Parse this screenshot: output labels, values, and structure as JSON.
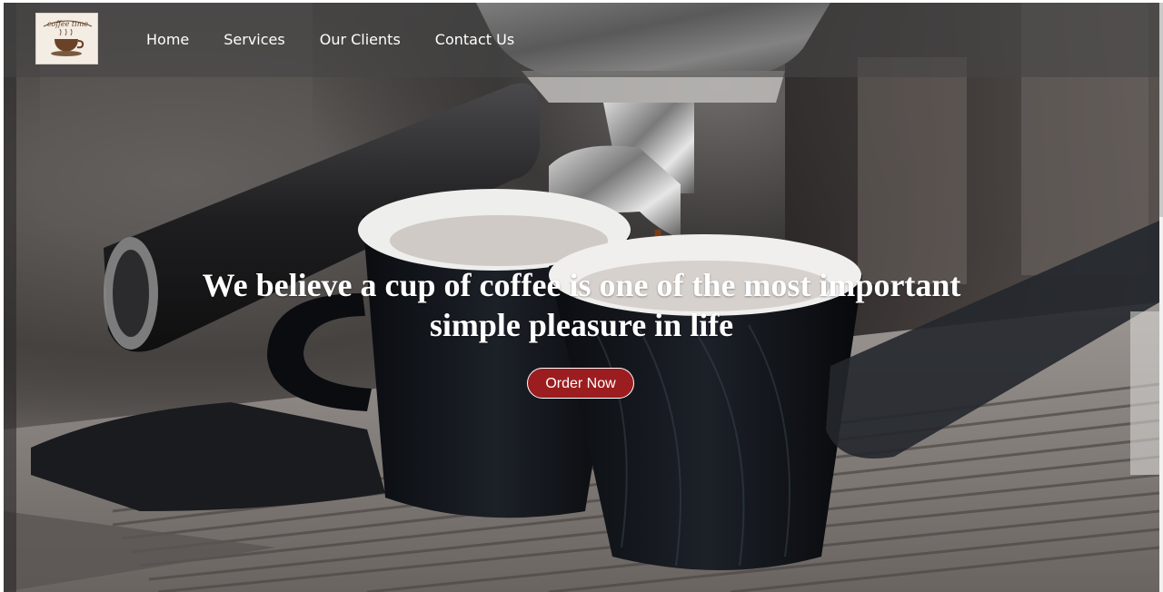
{
  "logo": {
    "text": "coffee time",
    "icon": "coffee-cup-icon"
  },
  "nav": {
    "items": [
      {
        "label": "Home"
      },
      {
        "label": "Services"
      },
      {
        "label": "Our Clients"
      },
      {
        "label": "Contact Us"
      }
    ]
  },
  "hero": {
    "headline_line1": "We believe a cup of coffee is one of the most important",
    "headline_line2": "simple pleasure in life",
    "cta_label": "Order Now",
    "cta_color": "#9b1d20",
    "background_image": "espresso-machine-photo"
  }
}
